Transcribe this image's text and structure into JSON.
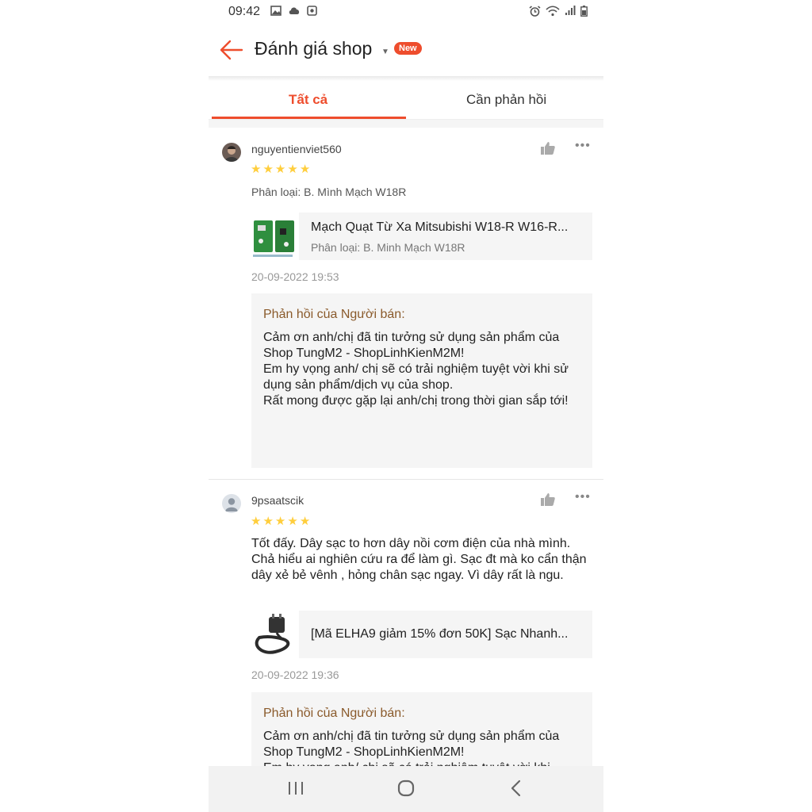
{
  "status_bar": {
    "time": "09:42",
    "left_icons": [
      "image-icon",
      "cloud-icon",
      "app-icon"
    ],
    "right_icons": [
      "alarm-icon",
      "wifi-icon",
      "signal-icon",
      "battery-icon"
    ]
  },
  "header": {
    "title": "Đánh giá shop",
    "badge": "New",
    "accent_color": "#ee4d2d"
  },
  "tabs": [
    {
      "label": "Tất cả",
      "active": true
    },
    {
      "label": "Cần phản hồi",
      "active": false
    }
  ],
  "reviews": [
    {
      "username": "nguyentienviet560",
      "rating": 5,
      "variant": "Phân loại: B. Mình Mạch W18R",
      "comment": "",
      "product": {
        "name": "Mạch Quạt Từ Xa Mitsubishi W18-R W16-R...",
        "variant": "Phân loại: B. Minh Mạch W18R"
      },
      "date": "20-09-2022 19:53",
      "reply": {
        "title": "Phản hồi của Người bán:",
        "text": "Cảm ơn anh/chị đã tin tưởng sử dụng sản phẩm của Shop TungM2 - ShopLinhKienM2M!\nEm hy vọng anh/ chị sẽ có trải nghiệm tuyệt vời khi sử dụng sản phẩm/dịch vụ của shop.\nRất mong được gặp lại anh/chị trong thời gian sắp tới!"
      }
    },
    {
      "username": "9psaatscik",
      "rating": 5,
      "variant": "",
      "comment": "Tốt đấy. Dây sạc to hơn dây nồi cơm điện của nhà mình. Chả hiểu ai nghiên cứu ra để làm gì. Sạc đt mà ko cẩn thận dây xẻ bẻ vênh , hỏng chân sạc ngay. Vì dây rất là ngu.",
      "product": {
        "name": "[Mã ELHA9 giảm 15% đơn 50K] Sạc Nhanh...",
        "variant": ""
      },
      "date": "20-09-2022 19:36",
      "reply": {
        "title": "Phản hồi của Người bán:",
        "text": "Cảm ơn anh/chị đã tin tưởng sử dụng sản phẩm của Shop TungM2 - ShopLinhKienM2M!\nEm hy vọng anh/ chị sẽ có trải nghiệm tuyệt vời khi"
      }
    }
  ],
  "nav": [
    "recent-apps-icon",
    "home-icon",
    "back-nav-icon"
  ]
}
